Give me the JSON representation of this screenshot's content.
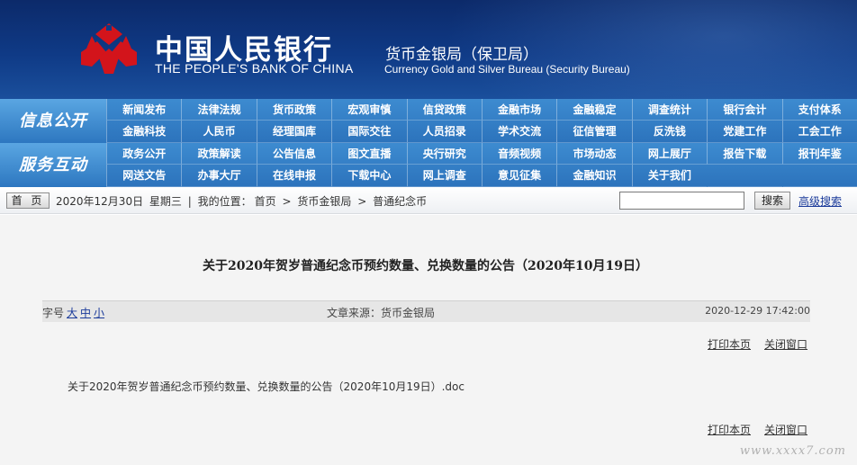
{
  "header": {
    "bank_name_cn": "中国人民银行",
    "bank_name_en": "THE PEOPLE'S BANK OF CHINA",
    "bureau_cn": "货币金银局（保卫局）",
    "bureau_en": "Currency  Gold and Silver Bureau (Security Bureau)",
    "logo_icon": "pboc-logo-icon",
    "colors": {
      "banner": "#0f3a86",
      "logo_red": "#d3141b",
      "nav": "#2c73bc"
    }
  },
  "nav": {
    "info_public": {
      "title": "信息公开",
      "row1": [
        "新闻发布",
        "法律法规",
        "货币政策",
        "宏观审慎",
        "信贷政策",
        "金融市场",
        "金融稳定",
        "调查统计",
        "银行会计",
        "支付体系"
      ],
      "row2": [
        "金融科技",
        "人民币",
        "经理国库",
        "国际交往",
        "人员招录",
        "学术交流",
        "征信管理",
        "反洗钱",
        "党建工作",
        "工会工作"
      ]
    },
    "service": {
      "title": "服务互动",
      "row1": [
        "政务公开",
        "政策解读",
        "公告信息",
        "图文直播",
        "央行研究",
        "音频视频",
        "市场动态",
        "网上展厅",
        "报告下载",
        "报刊年鉴"
      ],
      "row2": [
        "网送文告",
        "办事大厅",
        "在线申报",
        "下载中心",
        "网上调查",
        "意见征集",
        "金融知识",
        "关于我们",
        "",
        ""
      ]
    }
  },
  "crumb": {
    "home_label": "首 页",
    "date": "2020年12月30日",
    "weekday": "星期三",
    "sep": "|",
    "location_label": "我的位置：",
    "path": [
      "首页",
      "货币金银局",
      "普通纪念币"
    ],
    "arrow": ">",
    "search_value": "",
    "search_label": "搜索",
    "adv_search_label": "高级搜索"
  },
  "article": {
    "title": "关于2020年贺岁普通纪念币预约数量、兑换数量的公告（2020年10月19日）",
    "font_label": "字号",
    "font_sizes": [
      "大",
      "中",
      "小"
    ],
    "source": "文章来源：货币金银局",
    "datetime": "2020-12-29  17:42:00",
    "print_label": "打印本页",
    "close_label": "关闭窗口",
    "attachment": "关于2020年贺岁普通纪念币预约数量、兑换数量的公告（2020年10月19日）.doc",
    "print_label_2": "打印本页",
    "close_label_2": "关闭窗口"
  },
  "watermark": "www.xxxx7.com"
}
